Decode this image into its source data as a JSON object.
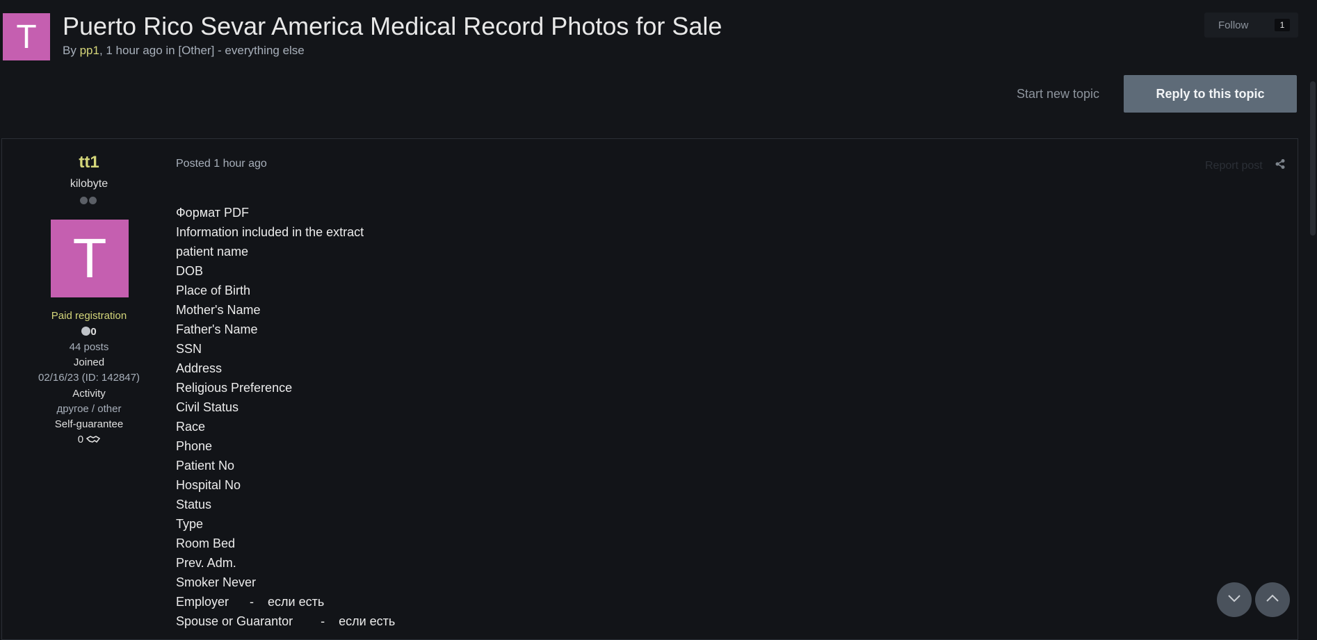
{
  "header": {
    "avatar_letter": "T",
    "title": "Puerto Rico Sevar America Medical Record Photos for Sale",
    "byline": {
      "prefix": "By ",
      "author": "pp1",
      "time_and_forum": ", 1 hour ago in [Other] - everything else"
    },
    "follow": {
      "label": "Follow",
      "count": "1"
    }
  },
  "actions": {
    "start_new_topic": "Start new topic",
    "reply": "Reply to this topic"
  },
  "post": {
    "author": {
      "name": "tt1",
      "rank": "kilobyte",
      "avatar_letter": "T",
      "group": "Paid registration",
      "reputation": "0",
      "posts": "44 posts",
      "joined_label": "Joined",
      "joined_value": "02/16/23 (ID: 142847)",
      "activity_label": "Activity",
      "activity_value": "другое / other",
      "guarantee_label": "Self-guarantee",
      "guarantee_value": "0"
    },
    "meta": "Posted 1 hour ago",
    "report": "Report post",
    "lines": [
      "Формат PDF",
      "Information included in the extract",
      "patient name",
      "DOB",
      "Place of Birth",
      "Mother's Name",
      "Father's Name",
      "SSN",
      "Address",
      "Religious Preference",
      "Civil Status",
      "Race",
      "Phone",
      "Patient No",
      "Hospital No",
      "Status",
      "Type",
      "Room Bed",
      "Prev. Adm.",
      "Smoker Never",
      "Employer      -    если есть",
      "Spouse or Guarantor        -    если есть"
    ]
  },
  "colors": {
    "background": "#131519",
    "accent_author": "#d7d77a",
    "avatar": "#c55fb0",
    "reply_button": "#5e6b78"
  },
  "icons": [
    "share-icon",
    "chevron-down-icon",
    "chevron-up-icon",
    "handshake-icon"
  ]
}
